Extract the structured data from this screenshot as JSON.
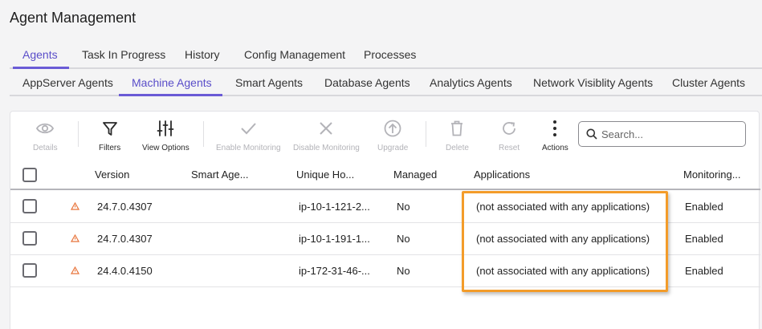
{
  "page": {
    "title": "Agent Management"
  },
  "tabs_main": [
    {
      "label": "Agents",
      "active": true
    },
    {
      "label": "Task In Progress",
      "active": false
    },
    {
      "label": "History",
      "active": false
    },
    {
      "label": "Config Management",
      "active": false
    },
    {
      "label": "Processes",
      "active": false
    }
  ],
  "tabs_sub": [
    {
      "label": "AppServer Agents",
      "active": false
    },
    {
      "label": "Machine Agents",
      "active": true
    },
    {
      "label": "Smart Agents",
      "active": false
    },
    {
      "label": "Database Agents",
      "active": false
    },
    {
      "label": "Analytics Agents",
      "active": false
    },
    {
      "label": "Network Visiblity Agents",
      "active": false
    },
    {
      "label": "Cluster Agents",
      "active": false
    }
  ],
  "toolbar": {
    "details": "Details",
    "filters": "Filters",
    "view_options": "View Options",
    "enable_monitoring": "Enable Monitoring",
    "disable_monitoring": "Disable Monitoring",
    "upgrade": "Upgrade",
    "delete": "Delete",
    "reset": "Reset",
    "actions": "Actions",
    "search_placeholder": "Search..."
  },
  "table": {
    "columns": [
      "Version",
      "Smart Age...",
      "Unique Ho...",
      "Managed",
      "Applications",
      "Monitoring..."
    ],
    "rows": [
      {
        "version": "24.7.0.4307",
        "smart_agent": "",
        "unique_host": "ip-10-1-121-2...",
        "managed": "No",
        "applications": "(not associated with any applications)",
        "monitoring": "Enabled"
      },
      {
        "version": "24.7.0.4307",
        "smart_agent": "",
        "unique_host": "ip-10-1-191-1...",
        "managed": "No",
        "applications": "(not associated with any applications)",
        "monitoring": "Enabled"
      },
      {
        "version": "24.4.0.4150",
        "smart_agent": "",
        "unique_host": "ip-172-31-46-...",
        "managed": "No",
        "applications": "(not associated with any applications)",
        "monitoring": "Enabled"
      }
    ]
  },
  "colors": {
    "accent": "#6a5bd6",
    "highlight": "#f39c2a",
    "warning": "#e8743b"
  }
}
